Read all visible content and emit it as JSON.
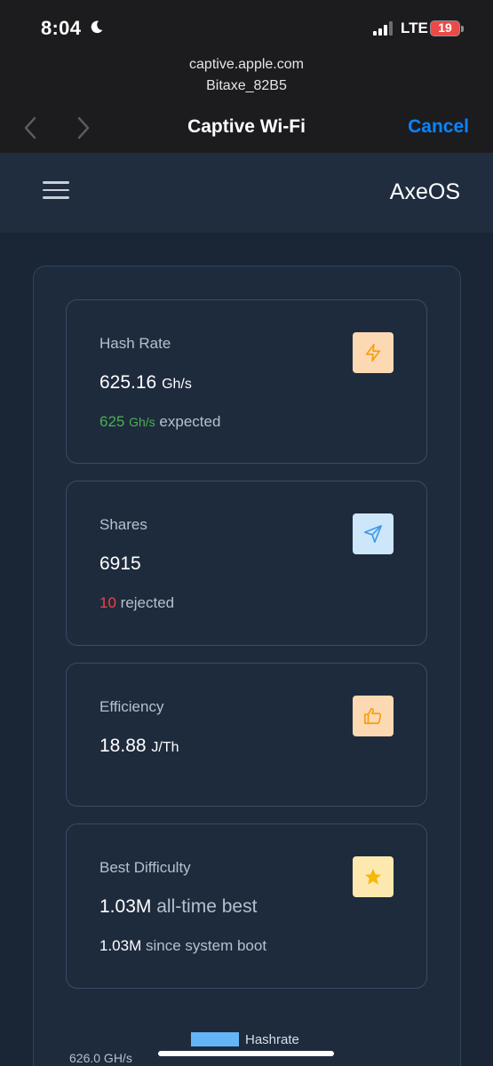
{
  "status_bar": {
    "time": "8:04",
    "network": "LTE",
    "battery": "19"
  },
  "browser": {
    "url": "captive.apple.com",
    "ssid": "Bitaxe_82B5",
    "title": "Captive Wi-Fi",
    "cancel_label": "Cancel"
  },
  "app": {
    "brand": "AxeOS"
  },
  "cards": {
    "hash_rate": {
      "label": "Hash Rate",
      "value": "625.16",
      "unit": "Gh/s",
      "expected_value": "625",
      "expected_unit": "Gh/s",
      "expected_label": "expected",
      "icon": "lightning-icon"
    },
    "shares": {
      "label": "Shares",
      "value": "6915",
      "rejected_value": "10",
      "rejected_label": "rejected",
      "icon": "send-icon"
    },
    "efficiency": {
      "label": "Efficiency",
      "value": "18.88",
      "unit": "J/Th",
      "icon": "thumbs-up-icon"
    },
    "best_difficulty": {
      "label": "Best Difficulty",
      "value": "1.03M",
      "value_suffix": "all-time best",
      "boot_value": "1.03M",
      "boot_label": "since system boot",
      "icon": "star-icon"
    }
  },
  "chart": {
    "legend_label": "Hashrate",
    "y_top_tick": "626.0 GH/s"
  },
  "colors": {
    "accent_blue": "#0a84ff",
    "green": "#4caf50",
    "red": "#ef4444",
    "series": "#64b5f6"
  }
}
